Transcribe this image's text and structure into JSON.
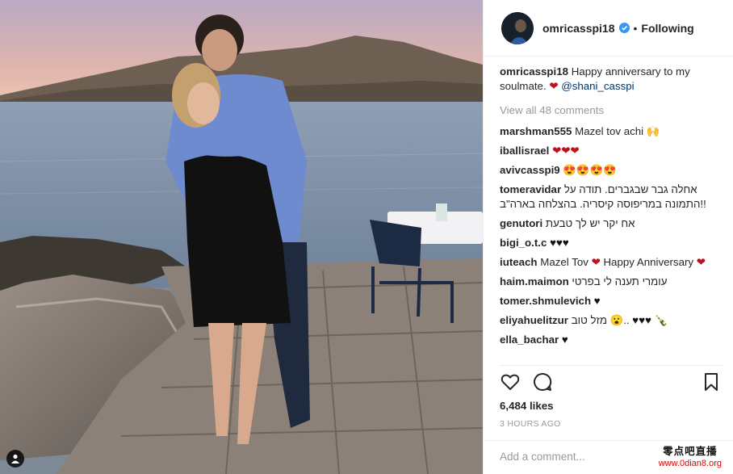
{
  "post": {
    "username": "omricasspi18",
    "follow_status": "Following",
    "separator": "•",
    "caption": {
      "username": "omricasspi18",
      "text": "Happy anniversary to my soulmate.",
      "emoji": "❤",
      "mention": "@shani_casspi"
    },
    "view_all_comments": "View all 48 comments",
    "comments": [
      {
        "user": "marshman555",
        "text": "Mazel tov achi 🙌"
      },
      {
        "user": "iballisrael",
        "text": "",
        "hearts": "❤❤❤"
      },
      {
        "user": "avivcasspi9",
        "text": "😍😍😍😍"
      },
      {
        "user": "tomeravidar",
        "text": "אחלה גבר שבגברים. תודה על התמונה במריפוסה קיסריה. בהצלחה בארה\"ב!!"
      },
      {
        "user": "genutori",
        "text": "אח יקר יש לך טבעת"
      },
      {
        "user": "bigi_o.t.c",
        "text": "",
        "black_hearts": "♥♥♥"
      },
      {
        "user": "iuteach",
        "text": "Mazel Tov",
        "hearts": "❤",
        "text2": "Happy Anniversary",
        "hearts2": "❤"
      },
      {
        "user": "haim.maimon",
        "text": "עומרי תענה לי בפרטי"
      },
      {
        "user": "tomer.shmulevich",
        "text": "",
        "black_hearts": "♥"
      },
      {
        "user": "eliyahuelitzur",
        "text": "מזל טוב 😮..",
        "black_hearts": "♥♥♥",
        "text2": "🍾"
      },
      {
        "user": "ella_bachar",
        "text": "",
        "black_hearts": "♥"
      }
    ],
    "likes": "6,484 likes",
    "time_ago": "3 HOURS AGO",
    "add_comment_placeholder": "Add a comment..."
  },
  "watermark": {
    "title": "零点吧直播",
    "url": "www.0dian8.org"
  },
  "icons": {
    "like": "heart-outline-icon",
    "comment": "speech-bubble-icon",
    "save": "bookmark-icon",
    "verified": "verified-badge-icon",
    "tag": "user-tag-icon"
  },
  "colors": {
    "verified": "#3897f0",
    "mention": "#003569",
    "heart": "#c2101c",
    "muted": "#999999"
  }
}
